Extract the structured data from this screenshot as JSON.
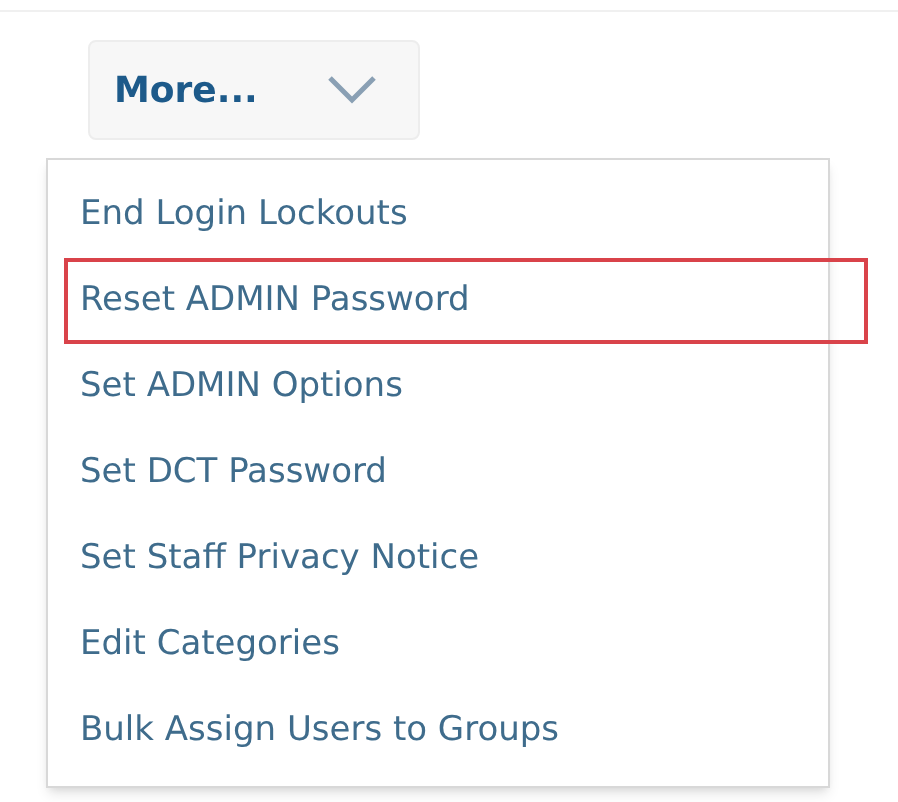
{
  "button": {
    "label": "More..."
  },
  "menu": {
    "items": [
      {
        "label": "End Login Lockouts",
        "selected": false
      },
      {
        "label": "Reset ADMIN Password",
        "selected": true
      },
      {
        "label": "Set ADMIN Options",
        "selected": false
      },
      {
        "label": "Set DCT Password",
        "selected": false
      },
      {
        "label": "Set Staff Privacy Notice",
        "selected": false
      },
      {
        "label": "Edit Categories",
        "selected": false
      },
      {
        "label": "Bulk Assign Users to Groups",
        "selected": false
      }
    ]
  }
}
